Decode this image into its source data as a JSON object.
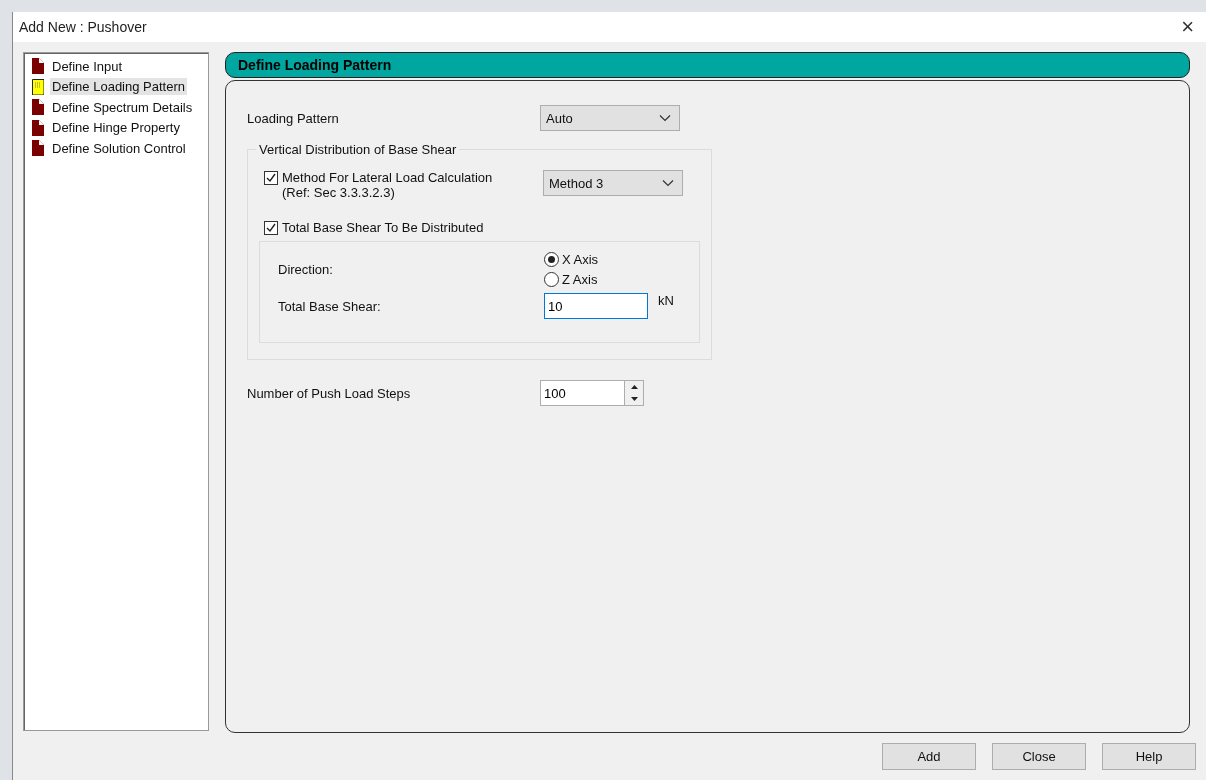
{
  "window": {
    "title": "Add New : Pushover",
    "close": "×"
  },
  "steps": [
    {
      "label": "Define Input",
      "selected": false
    },
    {
      "label": "Define Loading Pattern",
      "selected": true
    },
    {
      "label": "Define Spectrum Details",
      "selected": false
    },
    {
      "label": "Define Hinge Property",
      "selected": false
    },
    {
      "label": "Define Solution Control",
      "selected": false
    }
  ],
  "panel": {
    "title": "Define Loading Pattern",
    "loading_pattern": {
      "label": "Loading Pattern",
      "value": "Auto"
    },
    "group": {
      "title": "Vertical Distribution of Base Shear",
      "method": {
        "label": "Method For Lateral Load Calculation",
        "note": "(Ref: Sec 3.3.3.2.3)",
        "checked": true,
        "value": "Method 3"
      },
      "distribute": {
        "label": "Total Base Shear To Be Distributed",
        "checked": true
      },
      "direction": {
        "label": "Direction:",
        "options": [
          {
            "label": "X Axis",
            "selected": true
          },
          {
            "label": "Z Axis",
            "selected": false
          }
        ]
      },
      "base_shear": {
        "label": "Total Base Shear:",
        "value": "10",
        "unit": "kN"
      }
    },
    "push_steps": {
      "label": "Number of Push Load Steps",
      "value": "100"
    }
  },
  "buttons": [
    "Add",
    "Close",
    "Help"
  ]
}
